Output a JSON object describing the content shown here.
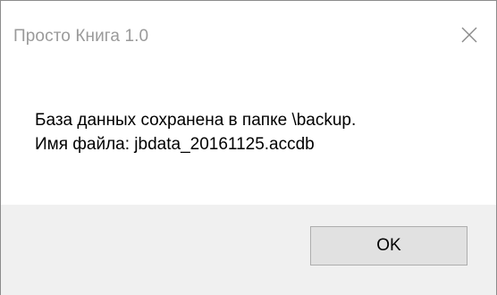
{
  "window": {
    "title": "Просто Книга 1.0",
    "close_icon": "close-icon"
  },
  "message": {
    "line1": "База данных сохранена в папке \\backup.",
    "line2": "Имя файла: jbdata_20161125.accdb"
  },
  "buttons": {
    "ok_label": "OK"
  }
}
